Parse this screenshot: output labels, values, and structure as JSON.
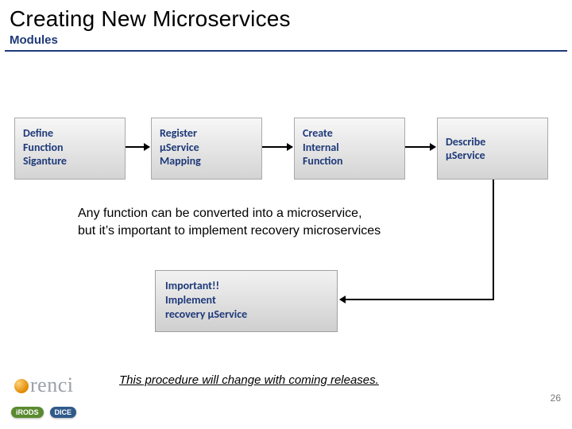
{
  "title": "Creating New Microservices",
  "subtitle": "Modules",
  "steps": [
    {
      "line1": "Define",
      "line2": "Function",
      "line3": "Siganture"
    },
    {
      "line1": "Register",
      "line2": "μService",
      "line3": "Mapping"
    },
    {
      "line1": "Create",
      "line2": "Internal",
      "line3": "Function"
    },
    {
      "line1": "Describe",
      "line2": "μService",
      "line3": ""
    }
  ],
  "note1_line1": "Any function can  be converted into a microservice,",
  "note1_line2": "but it’s important to implement recovery microservices",
  "important": {
    "line1": "Important!!",
    "line2": "Implement",
    "line3": " recovery μService"
  },
  "footer_note": "This procedure will change with coming releases.",
  "page_number": "26",
  "logos": {
    "renci": "renci",
    "irods": "iRODS",
    "dice": "DICE"
  }
}
